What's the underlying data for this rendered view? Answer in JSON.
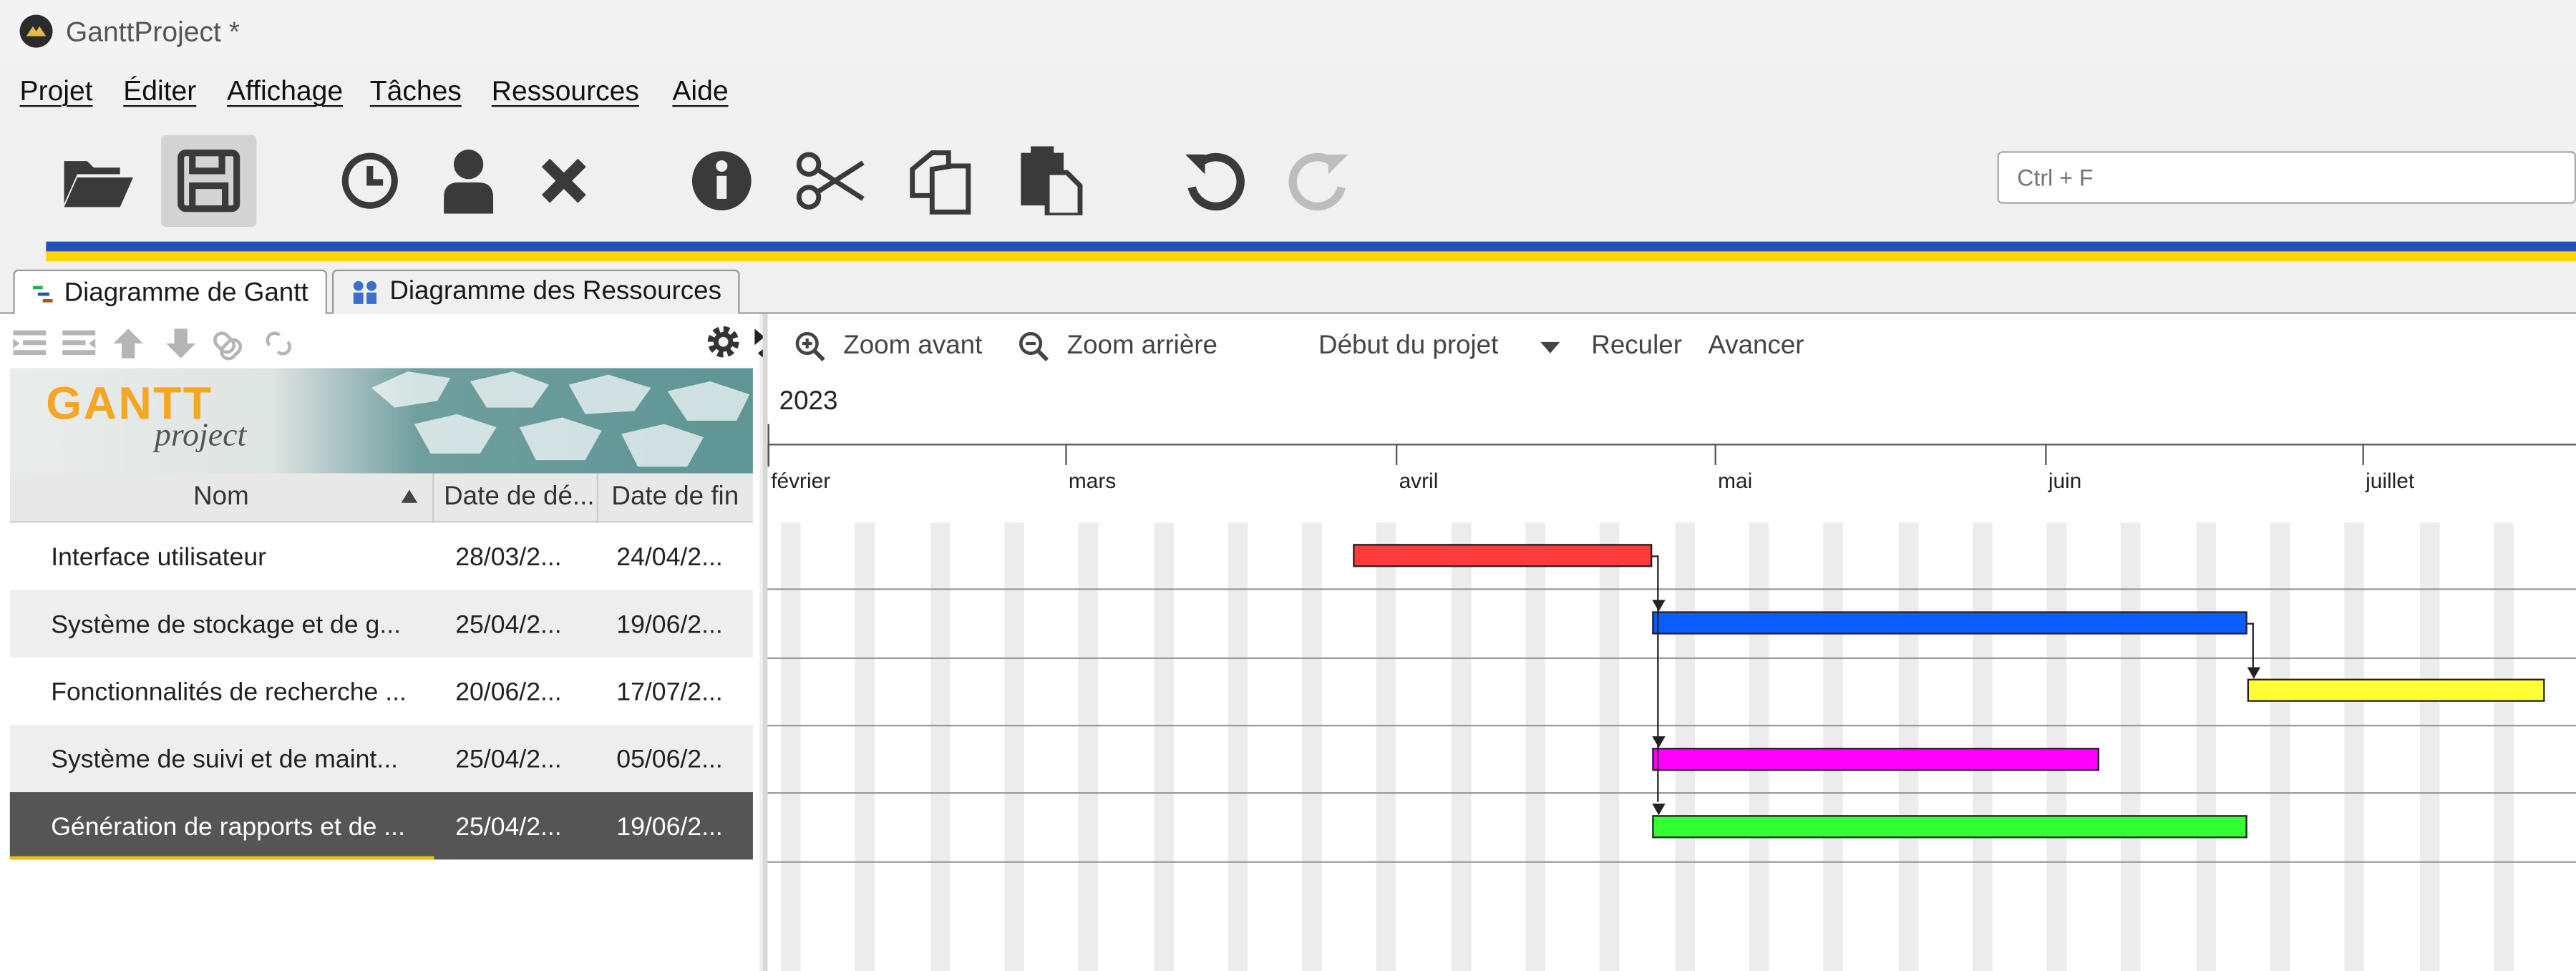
{
  "window": {
    "title": "GanttProject *"
  },
  "menu": [
    "Projet",
    "Éditer",
    "Affichage",
    "Tâches",
    "Ressources",
    "Aide"
  ],
  "toolbar": {
    "buttons": [
      "open-folder-icon",
      "save-icon",
      "clock-icon",
      "person-icon",
      "delete-icon",
      "info-icon",
      "scissors-icon",
      "copy-icon",
      "paste-icon",
      "undo-icon",
      "redo-icon"
    ],
    "search_placeholder": "Ctrl + F"
  },
  "tabs": [
    "Diagramme de Gantt",
    "Diagramme des Ressources"
  ],
  "task_table": {
    "columns": [
      "Nom",
      "Date de dé...",
      "Date de fin"
    ],
    "rows": [
      {
        "name": "Interface utilisateur",
        "start": "28/03/2...",
        "end": "24/04/2..."
      },
      {
        "name": "Système de stockage et de g...",
        "start": "25/04/2...",
        "end": "19/06/2..."
      },
      {
        "name": "Fonctionnalités de recherche ...",
        "start": "20/06/2...",
        "end": "17/07/2..."
      },
      {
        "name": "Système de suivi et de maint...",
        "start": "25/04/2...",
        "end": "05/06/2..."
      },
      {
        "name": "Génération de rapports et de ...",
        "start": "25/04/2...",
        "end": "19/06/2..."
      }
    ],
    "selected_row": 4
  },
  "logo": {
    "word1": "GANTT",
    "word2": "project"
  },
  "chart_toolbar": {
    "zoom_in": "Zoom avant",
    "zoom_out": "Zoom arrière",
    "project_start": "Début du projet",
    "back": "Reculer",
    "forward": "Avancer"
  },
  "timeline": {
    "year": "2023",
    "months": [
      "février",
      "mars",
      "avril",
      "mai",
      "juin",
      "juillet"
    ]
  },
  "colors": {
    "task1": "#ff3b3b",
    "task2": "#0a5cff",
    "task3": "#ffff33",
    "task4": "#ff00ff",
    "task5": "#33ff33",
    "selection": "#555555",
    "flag_blue": "#2353b8",
    "flag_yellow": "#ffd700"
  }
}
